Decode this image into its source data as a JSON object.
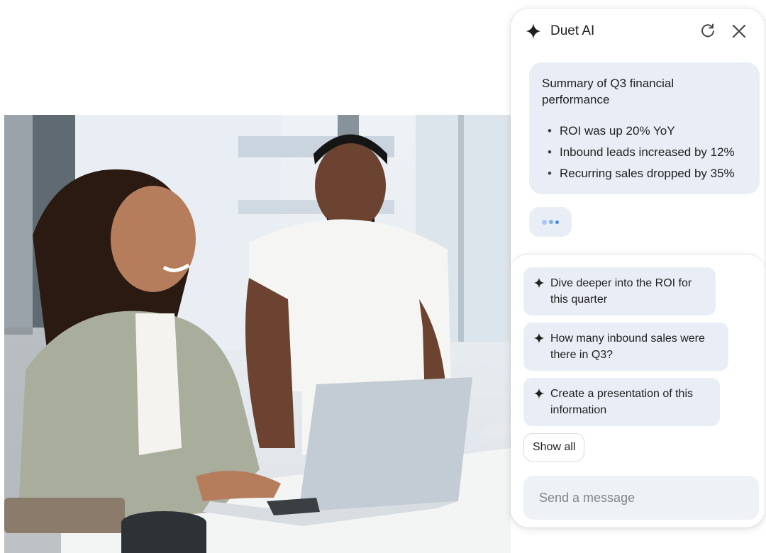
{
  "panel": {
    "title": "Duet AI",
    "refresh_icon": "refresh-icon",
    "close_icon": "close-icon",
    "logo_icon": "sparkle-icon"
  },
  "summary": {
    "title": "Summary of Q3 financial performance",
    "bullets": [
      "ROI was up 20% YoY",
      "Inbound leads increased by 12%",
      "Recurring sales dropped by 35%"
    ]
  },
  "suggestions": [
    "Dive deeper into the ROI for this quarter",
    "How many inbound sales were there in Q3?",
    "Create a presentation of this information"
  ],
  "show_all_label": "Show all",
  "message_input": {
    "placeholder": "Send a message",
    "value": ""
  },
  "colors": {
    "card_bg": "#e9eef6",
    "typing_dot_light": "#a8c7fa",
    "typing_dot_mid": "#7cacf8",
    "typing_dot_dark": "#4285f4"
  }
}
